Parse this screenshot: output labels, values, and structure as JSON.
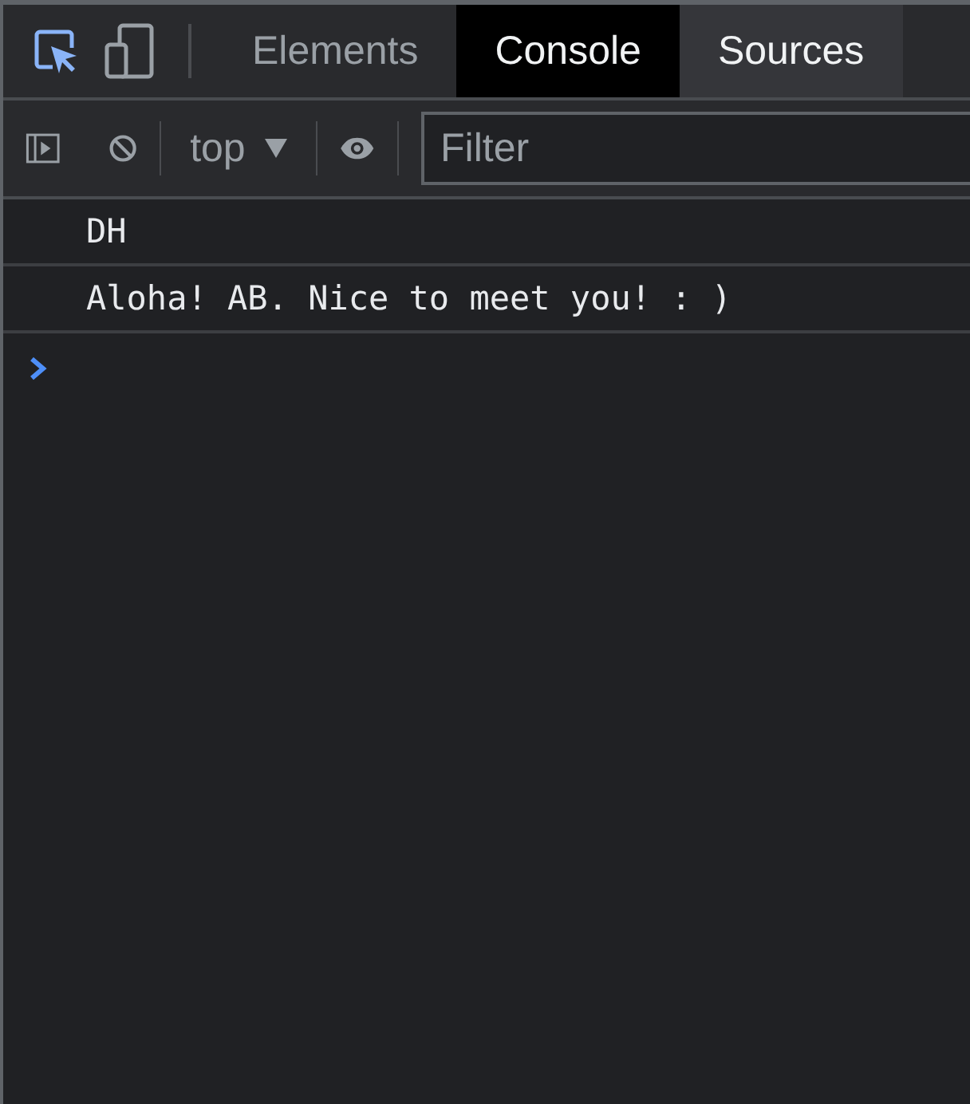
{
  "toolbar_top": {
    "inspect_active": true
  },
  "tabs": [
    {
      "label": "Elements",
      "selected": false,
      "hovered": false
    },
    {
      "label": "Console",
      "selected": true,
      "hovered": false
    },
    {
      "label": "Sources",
      "selected": false,
      "hovered": true
    }
  ],
  "console_toolbar": {
    "context": "top",
    "filter": {
      "placeholder": "Filter"
    }
  },
  "messages": [
    "DH",
    "Aloha! AB. Nice to meet you! : )"
  ]
}
